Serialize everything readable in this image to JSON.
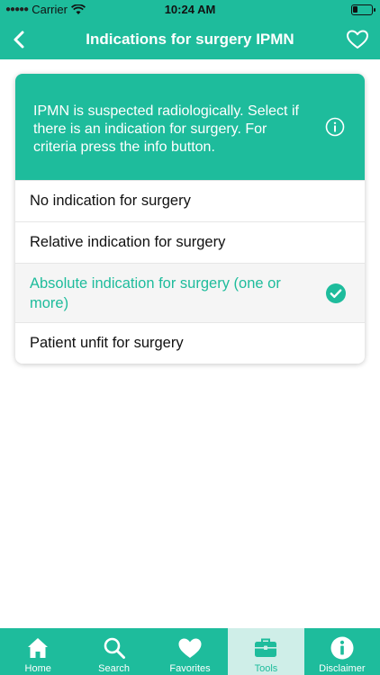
{
  "status_bar": {
    "carrier": "Carrier",
    "time": "10:24 AM"
  },
  "nav": {
    "title": "Indications for surgery IPMN"
  },
  "card": {
    "description": "IPMN is suspected radiologically. Select if there is an indication for surgery. For criteria press the info button.",
    "options": [
      {
        "label": "No indication for surgery",
        "selected": false
      },
      {
        "label": "Relative indication for surgery",
        "selected": false
      },
      {
        "label": "Absolute indication for surgery (one or more)",
        "selected": true
      },
      {
        "label": "Patient unfit for surgery",
        "selected": false
      }
    ]
  },
  "tab_bar": {
    "tabs": [
      {
        "label": "Home",
        "icon": "home-icon",
        "active": false
      },
      {
        "label": "Search",
        "icon": "search-icon",
        "active": false
      },
      {
        "label": "Favorites",
        "icon": "heart-icon",
        "active": false
      },
      {
        "label": "Tools",
        "icon": "toolbox-icon",
        "active": true
      },
      {
        "label": "Disclaimer",
        "icon": "info-icon",
        "active": false
      }
    ]
  },
  "colors": {
    "accent": "#1ebc9c",
    "active_tab_bg": "#cfeee8",
    "selected_row_bg": "#f5f5f5"
  }
}
